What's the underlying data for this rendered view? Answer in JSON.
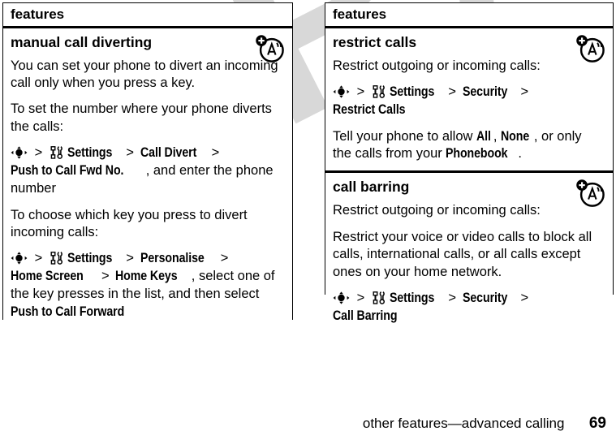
{
  "watermark": {
    "text": "DRAFT"
  },
  "left_panel": {
    "header": "features",
    "sections": [
      {
        "title": "manual call diverting",
        "icon": "network-feature-icon",
        "blocks": [
          {
            "kind": "text",
            "text": "You can set your phone to divert an incoming call only when you press a key."
          },
          {
            "kind": "text",
            "text": "To set the number where your phone diverts the calls:"
          },
          {
            "kind": "path",
            "nav_icon": "nav-key-icon",
            "tools_icon": "tools-icon",
            "items": [
              "Settings",
              "Call Divert",
              "Push to Call Fwd No."
            ],
            "trailing": ", and enter the phone number"
          },
          {
            "kind": "text",
            "text": "To choose which key you press to divert incoming calls:"
          },
          {
            "kind": "path",
            "nav_icon": "nav-key-icon",
            "tools_icon": "tools-icon",
            "items": [
              "Settings",
              "Personalise",
              "Home Screen",
              "Home Keys"
            ],
            "trailing": ", select one of the key presses in the list, and then select ",
            "trailing_bold": "Push to Call Forward"
          }
        ]
      }
    ]
  },
  "right_panel": {
    "header": "features",
    "sections": [
      {
        "title": "restrict calls",
        "icon": "network-feature-icon",
        "blocks": [
          {
            "kind": "text",
            "text": "Restrict outgoing or incoming calls:"
          },
          {
            "kind": "path",
            "nav_icon": "nav-key-icon",
            "tools_icon": "tools-icon",
            "items": [
              "Settings",
              "Security",
              "Restrict Calls"
            ]
          },
          {
            "kind": "rich",
            "lead": "Tell your phone to allow ",
            "bold1": "All",
            "mid1": ", ",
            "bold2": "None",
            "mid2": ", or only the calls from your ",
            "bold3": "Phonebook",
            "tail": "."
          }
        ]
      },
      {
        "title": "call barring",
        "icon": "network-feature-icon",
        "blocks": [
          {
            "kind": "text",
            "text": "Restrict outgoing or incoming calls:"
          },
          {
            "kind": "text",
            "text": "Restrict your voice or video calls to block all calls, international calls, or all calls except ones on your home network."
          },
          {
            "kind": "path",
            "nav_icon": "nav-key-icon",
            "tools_icon": "tools-icon",
            "items": [
              "Settings",
              "Security",
              "Call Barring"
            ]
          }
        ]
      }
    ]
  },
  "footer": {
    "breadcrumb": "other features—advanced calling",
    "page_number": "69"
  },
  "separators": {
    "chevron": ">"
  },
  "colors": {
    "text": "#000000",
    "page_background": "#ffffff",
    "watermark": "#d8d8d8",
    "rule": "#000000"
  }
}
